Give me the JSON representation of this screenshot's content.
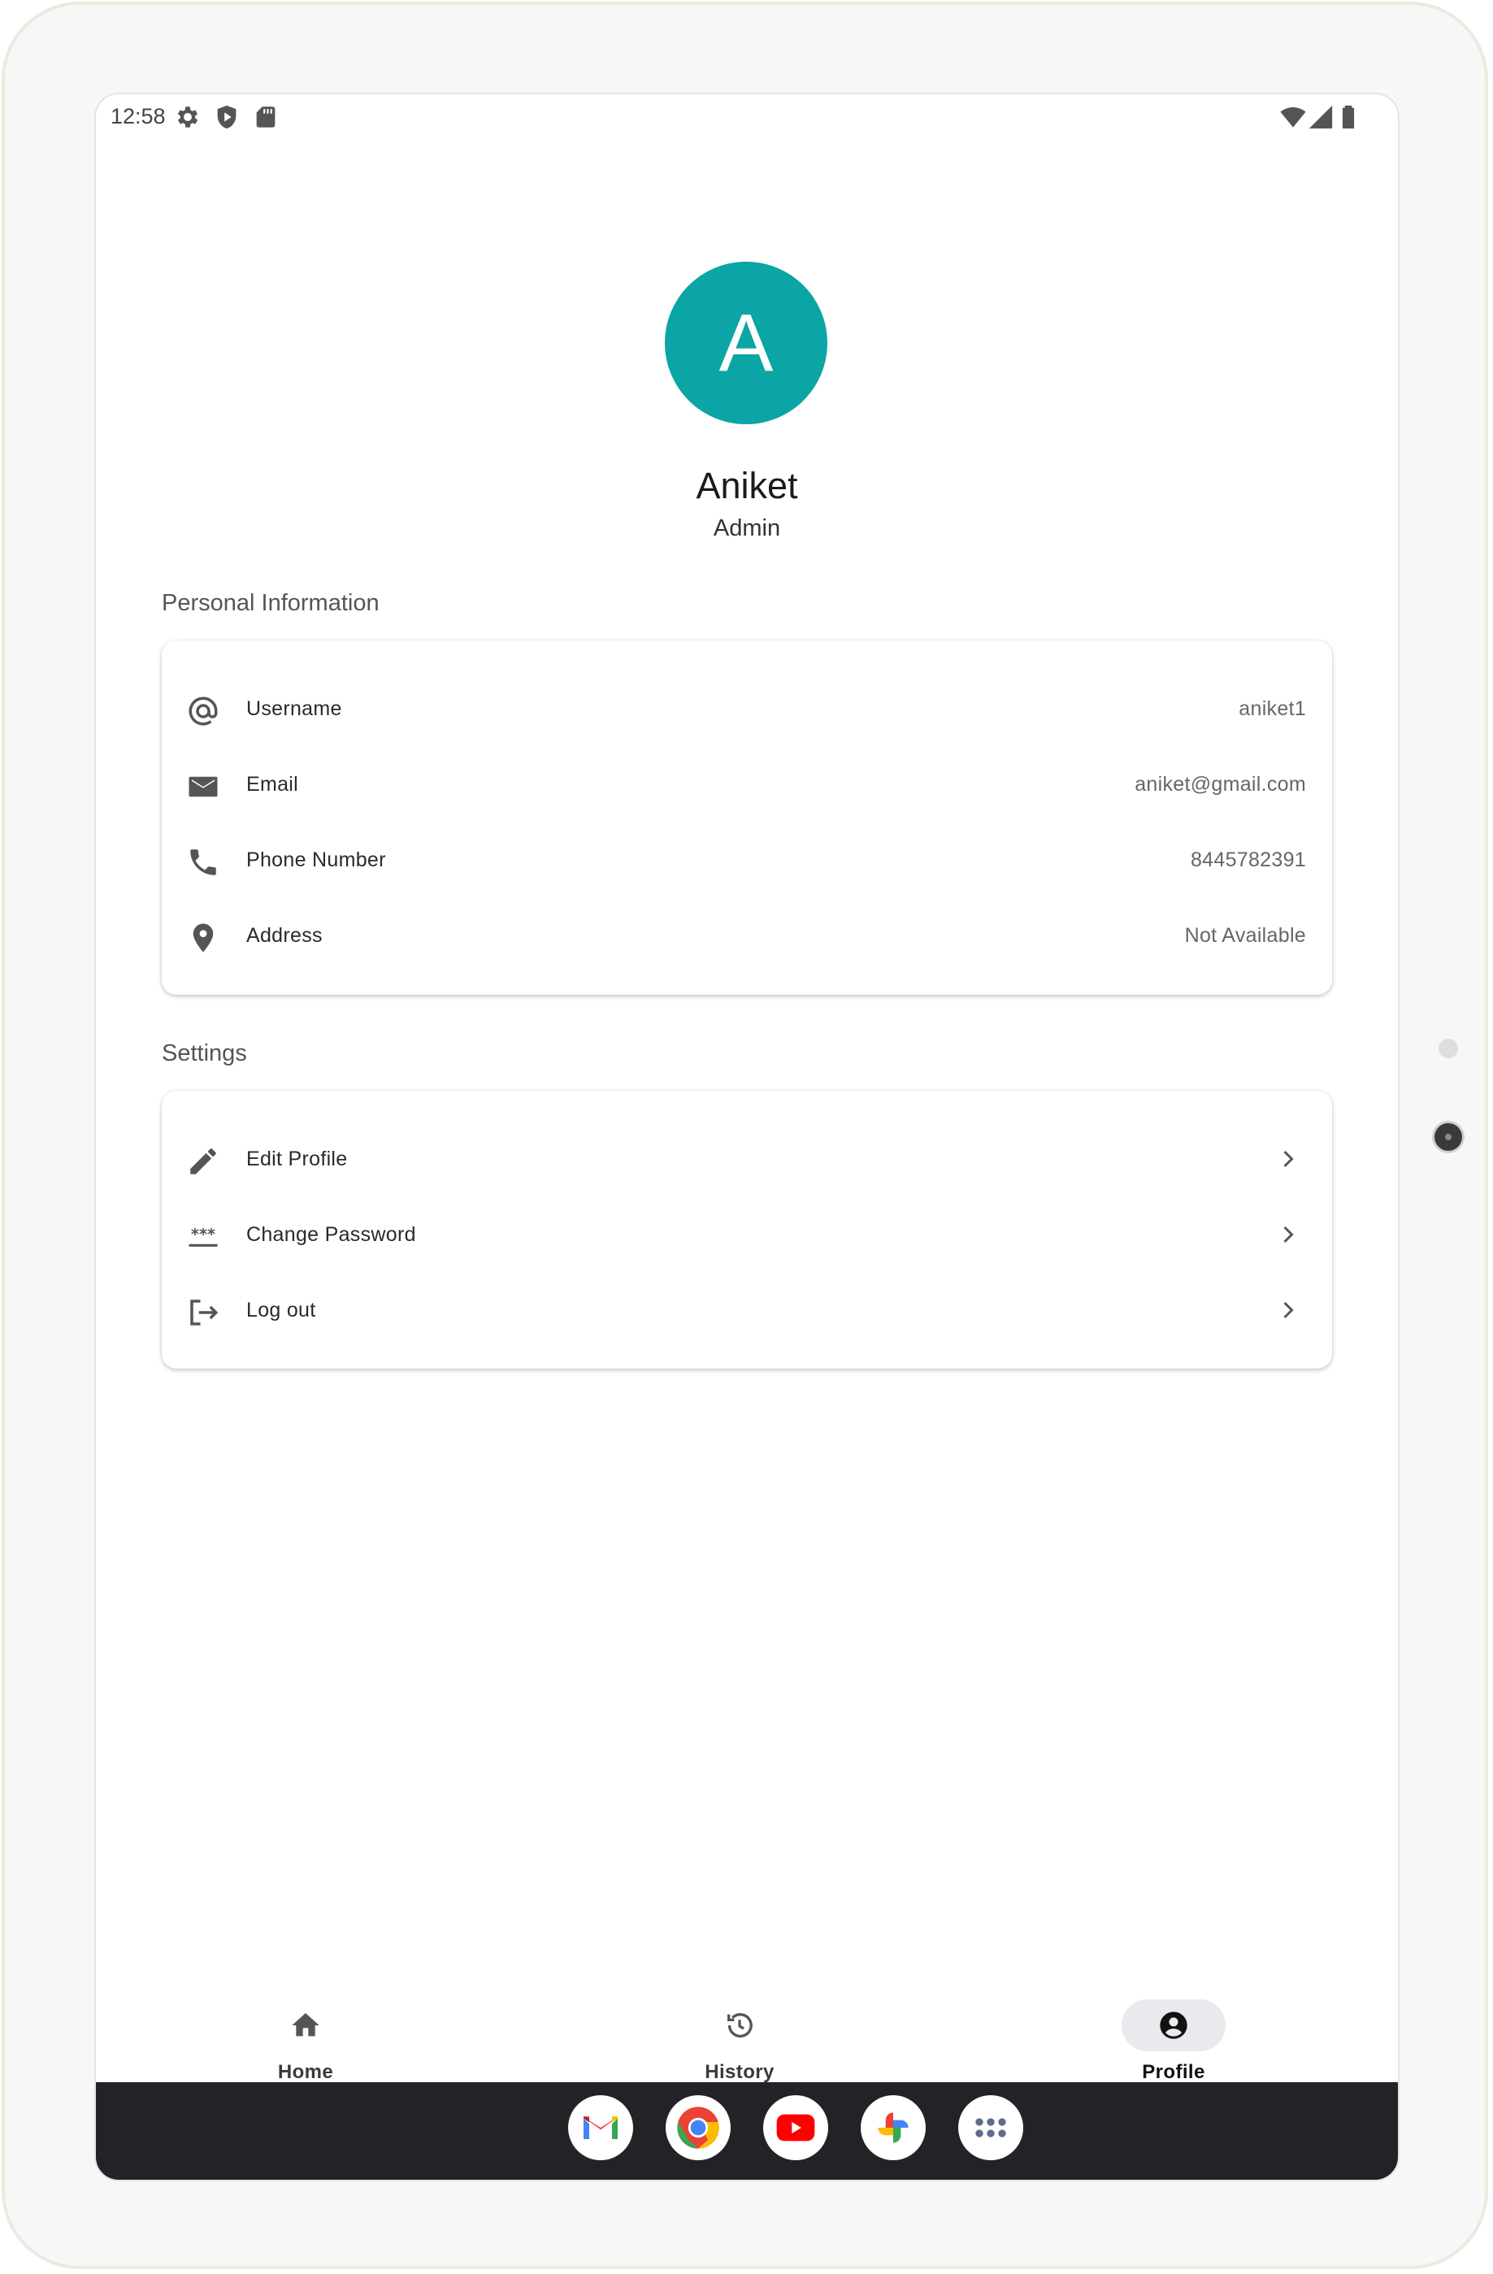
{
  "status_bar": {
    "time": "12:58",
    "left_icons": [
      "settings-icon",
      "shield-icon",
      "sd-card-icon"
    ],
    "right_icons": [
      "wifi-icon",
      "cell-signal-icon",
      "battery-icon"
    ]
  },
  "profile": {
    "avatar_letter": "A",
    "avatar_color": "#0BA5A5",
    "name": "Aniket",
    "role": "Admin"
  },
  "personal_info": {
    "title": "Personal Information",
    "rows": [
      {
        "icon": "at-sign-icon",
        "label": "Username",
        "value": "aniket1"
      },
      {
        "icon": "email-icon",
        "label": "Email",
        "value": "aniket@gmail.com"
      },
      {
        "icon": "phone-icon",
        "label": "Phone Number",
        "value": "8445782391"
      },
      {
        "icon": "location-pin-icon",
        "label": "Address",
        "value": "Not Available"
      }
    ]
  },
  "settings": {
    "title": "Settings",
    "rows": [
      {
        "icon": "pencil-icon",
        "label": "Edit Profile"
      },
      {
        "icon": "password-icon",
        "label": "Change Password"
      },
      {
        "icon": "logout-icon",
        "label": "Log out"
      }
    ]
  },
  "bottom_nav": {
    "items": [
      {
        "icon": "home-icon",
        "label": "Home",
        "active": false
      },
      {
        "icon": "history-icon",
        "label": "History",
        "active": false
      },
      {
        "icon": "account-circle-icon",
        "label": "Profile",
        "active": true
      }
    ]
  },
  "taskbar": {
    "apps": [
      "gmail-icon",
      "chrome-icon",
      "youtube-icon",
      "photos-icon",
      "app-drawer-icon"
    ]
  }
}
